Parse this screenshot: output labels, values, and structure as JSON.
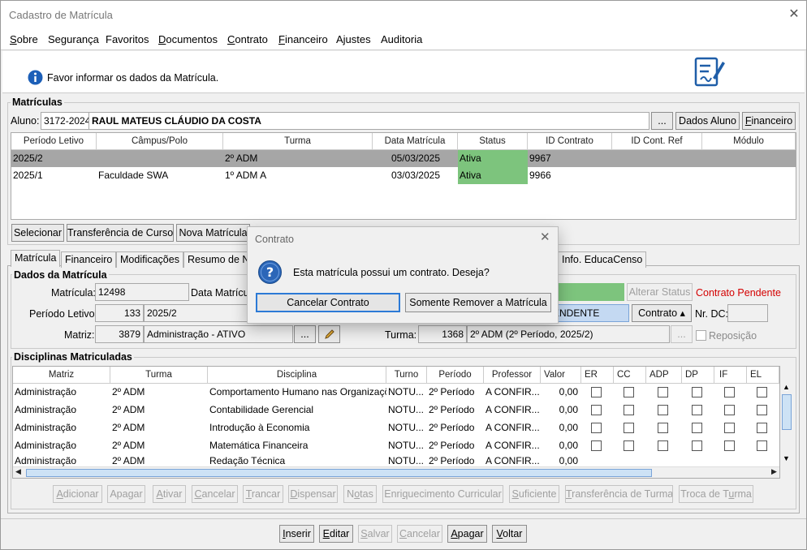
{
  "window": {
    "title": "Cadastro de Matrícula",
    "close_icon": "close-icon"
  },
  "menu": [
    {
      "pre": "",
      "u": "S",
      "post": "obre"
    },
    {
      "pre": "Segurança",
      "u": "",
      "post": ""
    },
    {
      "pre": "Favoritos",
      "u": "",
      "post": ""
    },
    {
      "pre": "",
      "u": "D",
      "post": "ocumentos"
    },
    {
      "pre": "",
      "u": "C",
      "post": "ontrato"
    },
    {
      "pre": "",
      "u": "F",
      "post": "inanceiro"
    },
    {
      "pre": "Ajustes",
      "u": "",
      "post": ""
    },
    {
      "pre": "Auditoria",
      "u": "",
      "post": ""
    }
  ],
  "info": {
    "message": "Favor informar os dados da Matrícula."
  },
  "matriculas": {
    "group_title": "Matrículas",
    "aluno_label": "Aluno:",
    "aluno_code": "3172-2024",
    "aluno_name": "RAUL MATEUS CLÁUDIO DA COSTA",
    "ellipsis": "...",
    "dados_aluno": "Dados Aluno",
    "financeiro_pre": "",
    "financeiro_u": "F",
    "financeiro_post": "inanceiro",
    "headers": [
      "Período Letivo",
      "Câmpus/Polo",
      "Turma",
      "Data Matrícula",
      "Status",
      "ID Contrato",
      "ID Cont. Ref",
      "Módulo"
    ],
    "rows": [
      [
        "2025/2",
        "",
        "2º ADM",
        "05/03/2025",
        "Ativa",
        "9967",
        "",
        ""
      ],
      [
        "2025/1",
        "Faculdade SWA",
        "1º ADM A",
        "03/03/2025",
        "Ativa",
        "9966",
        "",
        ""
      ]
    ],
    "buttons": {
      "selecionar": "Selecionar",
      "transferencia": "Transferência de Curso",
      "nova": "Nova Matrícula"
    }
  },
  "tabs": [
    "Matrícula",
    "Financeiro",
    "Modificações",
    "Resumo de No",
    "Info. EducaCenso"
  ],
  "dados": {
    "group_title": "Dados da Matrícula",
    "matricula_label": "Matrícula:",
    "matricula_value": "12498",
    "data_label": "Data Matrícul",
    "alterar_status": "Alterar Status",
    "contrato_pendente": "Contrato Pendente",
    "periodo_label": "Período Letivo:",
    "periodo_code": "133",
    "periodo_value": "2025/2",
    "status_value": "ENDENTE",
    "contrato_button": "Contrato",
    "nrdc_label": "Nr. DC:",
    "matriz_label": "Matriz:",
    "matriz_code": "3879",
    "matriz_value": "Administração - ATIVO",
    "turma_label": "Turma:",
    "turma_code": "1368",
    "turma_value": "2º ADM (2º Período, 2025/2)",
    "reposicao_label": "Reposição"
  },
  "disciplinas": {
    "group_title": "Disciplinas Matriculadas",
    "headers": [
      "Matriz",
      "Turma",
      "Disciplina",
      "Turno",
      "Período",
      "Professor",
      "Valor",
      "ER",
      "CC",
      "ADP",
      "DP",
      "IF",
      "EL"
    ],
    "rows": [
      [
        "Administração",
        "2º ADM",
        "Comportamento Humano nas Organizações",
        "NOTU...",
        "2º Período",
        "A CONFIR...",
        "0,00"
      ],
      [
        "Administração",
        "2º ADM",
        "Contabilidade Gerencial",
        "NOTU...",
        "2º Período",
        "A CONFIR...",
        "0,00"
      ],
      [
        "Administração",
        "2º ADM",
        "Introdução à Economia",
        "NOTU...",
        "2º Período",
        "A CONFIR...",
        "0,00"
      ],
      [
        "Administração",
        "2º ADM",
        "Matemática Financeira",
        "NOTU...",
        "2º Período",
        "A CONFIR...",
        "0,00"
      ],
      [
        "Administração",
        "2º ADM",
        "Redação Técnica",
        "NOTU...",
        "2º Período",
        "A CONFIR...",
        "0,00"
      ]
    ],
    "buttons": [
      {
        "pre": "",
        "u": "A",
        "post": "dicionar"
      },
      {
        "pre": "Apa",
        "u": "g",
        "post": "ar"
      },
      {
        "pre": "",
        "u": "A",
        "post": "tivar"
      },
      {
        "pre": "",
        "u": "C",
        "post": "ancelar"
      },
      {
        "pre": "",
        "u": "T",
        "post": "rancar"
      },
      {
        "pre": "",
        "u": "D",
        "post": "ispensar"
      },
      {
        "pre": "N",
        "u": "o",
        "post": "tas"
      },
      {
        "pre": "Enri",
        "u": "q",
        "post": "uecimento Curricular"
      },
      {
        "pre": "",
        "u": "S",
        "post": "uficiente"
      },
      {
        "pre": "",
        "u": "T",
        "post": "ransferência de Turma"
      },
      {
        "pre": "Troca de T",
        "u": "u",
        "post": "rma"
      }
    ]
  },
  "footer": [
    {
      "pre": "",
      "u": "I",
      "post": "nserir"
    },
    {
      "pre": "",
      "u": "E",
      "post": "ditar"
    },
    {
      "pre": "",
      "u": "S",
      "post": "alvar"
    },
    {
      "pre": "",
      "u": "C",
      "post": "ancelar"
    },
    {
      "pre": "",
      "u": "A",
      "post": "pagar"
    },
    {
      "pre": "",
      "u": "V",
      "post": "oltar"
    }
  ],
  "dialog": {
    "title": "Contrato",
    "message": "Esta matrícula possui um contrato. Deseja?",
    "cancel_button": "Cancelar Contrato",
    "remove_button": "Somente Remover a Matrícula"
  },
  "colors": {
    "status_active": "#7dc47d",
    "selected_row": "#a6a6a6",
    "pending_text": "#d40000",
    "info_icon": "#1c5fb8"
  }
}
